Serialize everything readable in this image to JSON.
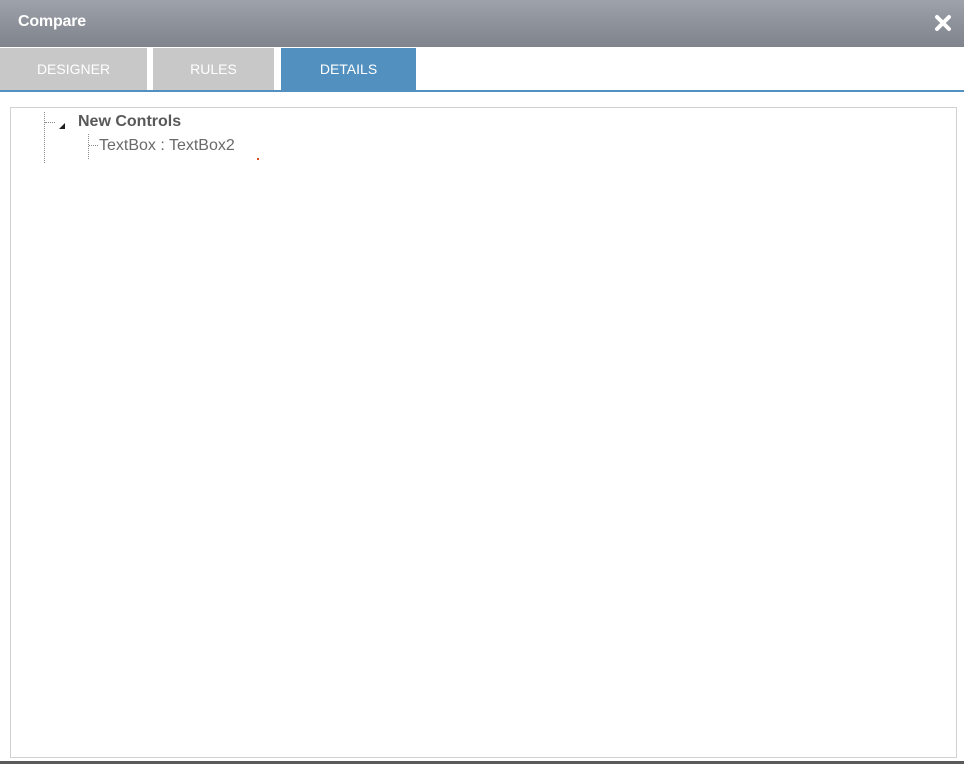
{
  "dialog": {
    "title": "Compare",
    "close_icon": "close-icon"
  },
  "tabs": [
    {
      "label": "DESIGNER",
      "active": false
    },
    {
      "label": "RULES",
      "active": false
    },
    {
      "label": "DETAILS",
      "active": true
    }
  ],
  "tree": {
    "root": {
      "label": "New Controls",
      "expanded": true,
      "toggle_icon": "triangle-down-icon"
    },
    "children": [
      {
        "label": "TextBox : TextBox2"
      }
    ]
  },
  "colors": {
    "titlebar": "#8c9099",
    "tab_inactive": "#c8c8c8",
    "tab_active": "#5190bf",
    "accent": "#5190bf"
  }
}
